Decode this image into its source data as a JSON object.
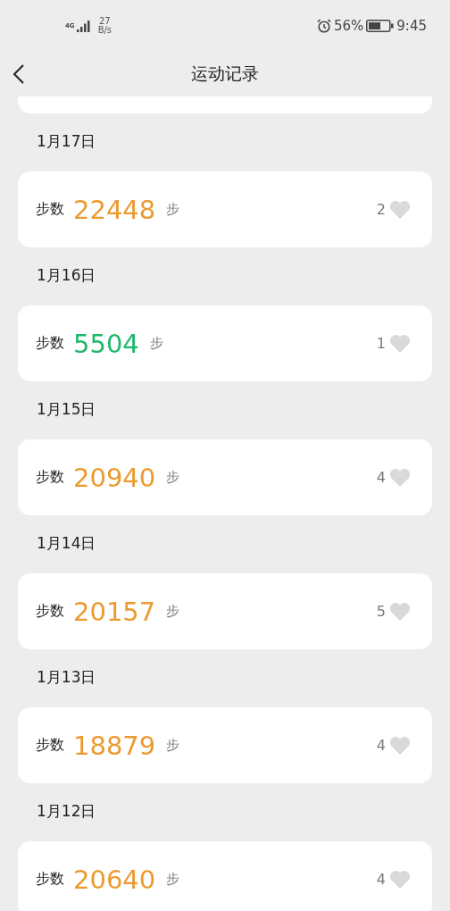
{
  "status_bar": {
    "network": "4G",
    "speed_value": "27",
    "speed_unit": "B/s",
    "battery": "56%",
    "time": "9:45"
  },
  "nav": {
    "title": "运动记录"
  },
  "records": [
    {
      "date": "1月17日",
      "label": "步数",
      "steps": "22448",
      "unit": "步",
      "likes": "2",
      "color": "#eb9a2f"
    },
    {
      "date": "1月16日",
      "label": "步数",
      "steps": "5504",
      "unit": "步",
      "likes": "1",
      "color": "#1fb86a"
    },
    {
      "date": "1月15日",
      "label": "步数",
      "steps": "20940",
      "unit": "步",
      "likes": "4",
      "color": "#eb9a2f"
    },
    {
      "date": "1月14日",
      "label": "步数",
      "steps": "20157",
      "unit": "步",
      "likes": "5",
      "color": "#eb9a2f"
    },
    {
      "date": "1月13日",
      "label": "步数",
      "steps": "18879",
      "unit": "步",
      "likes": "4",
      "color": "#eb9a2f"
    },
    {
      "date": "1月12日",
      "label": "步数",
      "steps": "20640",
      "unit": "步",
      "likes": "4",
      "color": "#eb9a2f"
    }
  ]
}
